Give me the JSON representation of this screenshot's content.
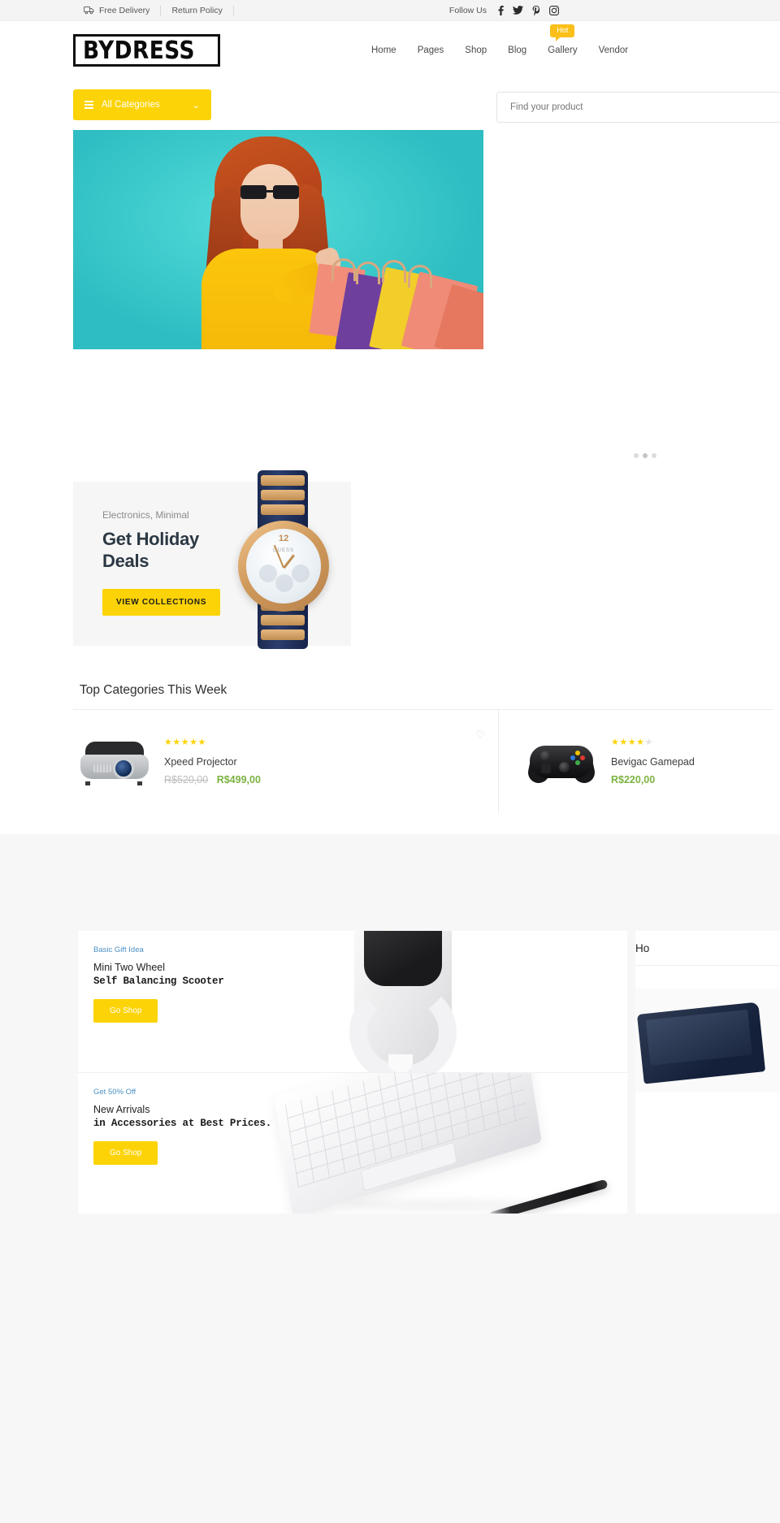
{
  "topbar": {
    "items": [
      {
        "label": "Free Delivery",
        "icon": "truck-icon"
      },
      {
        "label": "Return Policy",
        "icon": null
      }
    ],
    "follow_label": "Follow Us",
    "social": [
      {
        "name": "facebook-icon",
        "glyph": "f"
      },
      {
        "name": "twitter-icon",
        "glyph": "t"
      },
      {
        "name": "pinterest-icon",
        "glyph": "P"
      },
      {
        "name": "instagram-icon",
        "glyph": "ig"
      }
    ]
  },
  "header": {
    "logo": "BYDRESS",
    "nav": [
      {
        "label": "Home",
        "badge": null
      },
      {
        "label": "Pages",
        "badge": null
      },
      {
        "label": "Shop",
        "badge": null
      },
      {
        "label": "Blog",
        "badge": null
      },
      {
        "label": "Gallery",
        "badge": "Hot"
      },
      {
        "label": "Vendor",
        "badge": null
      }
    ]
  },
  "searchrow": {
    "categories_label": "All Categories",
    "categories_icon": "list-icon",
    "chevron_icon": "chevron-down-icon",
    "search_placeholder": "Find your product",
    "search_value": ""
  },
  "hero": {
    "alt": "woman-with-shopping-bags-slide",
    "dots": 3,
    "active_dot": 2
  },
  "promo": {
    "kicker": "Electronics, Minimal",
    "title_line1": "Get Holiday",
    "title_line2": "Deals",
    "button": "VIEW COLLECTIONS",
    "product_image": "wrist-watch-image"
  },
  "categories": {
    "title": "Top Categories This Week",
    "products": [
      {
        "name": "Xpeed Projector",
        "rating": 5,
        "max_rating": 5,
        "price_old": "R$520,00",
        "price_new": "R$499,00",
        "image": "projector-image",
        "wishlist_icon": "heart-icon"
      },
      {
        "name": "Bevigac Gamepad",
        "rating": 4,
        "max_rating": 5,
        "price_old": "",
        "price_new": "R$220,00",
        "image": "gamepad-image",
        "wishlist_icon": "heart-icon"
      }
    ]
  },
  "banners": [
    {
      "kicker": "Basic Gift Idea",
      "line1": "Mini Two Wheel",
      "line2": "Self Balancing Scooter",
      "button": "Go Shop",
      "art": "smartwatch-image"
    },
    {
      "kicker": "Get 50% Off",
      "line1": "New Arrivals",
      "line2": "in Accessories at Best Prices.",
      "button": "Go Shop",
      "art": "keyboard-stylus-image"
    }
  ],
  "side_panel": {
    "title": "Ho",
    "card_art": "laptop-image"
  },
  "colors": {
    "accent_yellow": "#fcd307",
    "badge_amber": "#fac019",
    "price_green": "#7cb342",
    "kicker_blue": "#4a90c4",
    "dark_navy": "#2c3844"
  }
}
